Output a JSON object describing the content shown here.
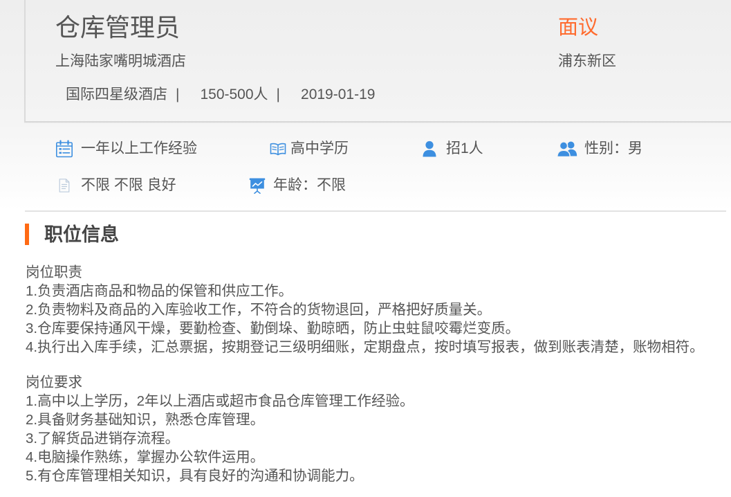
{
  "job": {
    "title": "仓库管理员",
    "salary": "面议",
    "company": "上海陆家嘴明城酒店",
    "location": "浦东新区",
    "tags": [
      "国际四星级酒店",
      "150-500人",
      "2019-01-19"
    ],
    "tag_separator": "|"
  },
  "requirements": [
    {
      "icon": "calendar-icon",
      "text": "一年以上工作经验"
    },
    {
      "icon": "book-icon",
      "text": "高中学历"
    },
    {
      "icon": "person-icon",
      "text": "招1人"
    },
    {
      "icon": "group-icon",
      "text": "性别：男"
    },
    {
      "icon": "document-icon",
      "text": "不限 不限 良好"
    },
    {
      "icon": "presentation-icon",
      "text": "年龄：不限"
    }
  ],
  "section": {
    "title": "职位信息"
  },
  "description": {
    "responsibilities": {
      "heading": "岗位职责",
      "items": [
        "1.负责酒店商品和物品的保管和供应工作。",
        "2.负责物料及商品的入库验收工作，不符合的货物退回，严格把好质量关。",
        "3.仓库要保持通风干燥，要勤检查、勤倒垛、勤晾晒，防止虫蛀鼠咬霉烂变质。",
        "4.执行出入库手续，汇总票据，按期登记三级明细账，定期盘点，按时填写报表，做到账表清楚，账物相符。"
      ]
    },
    "qualifications": {
      "heading": "岗位要求",
      "items": [
        "1.高中以上学历，2年以上酒店或超市食品仓库管理工作经验。",
        "2.具备财务基础知识，熟悉仓库管理。",
        "3.了解货品进销存流程。",
        "4.电脑操作熟练，掌握办公软件运用。",
        "5.有仓库管理相关知识，具有良好的沟通和协调能力。"
      ]
    }
  },
  "colors": {
    "accent": "#ff6a14",
    "salary": "#ff6b2e",
    "icon": "#3d8fe0",
    "icon_muted": "#bccbdc",
    "text": "#555555",
    "heading": "#444444"
  }
}
